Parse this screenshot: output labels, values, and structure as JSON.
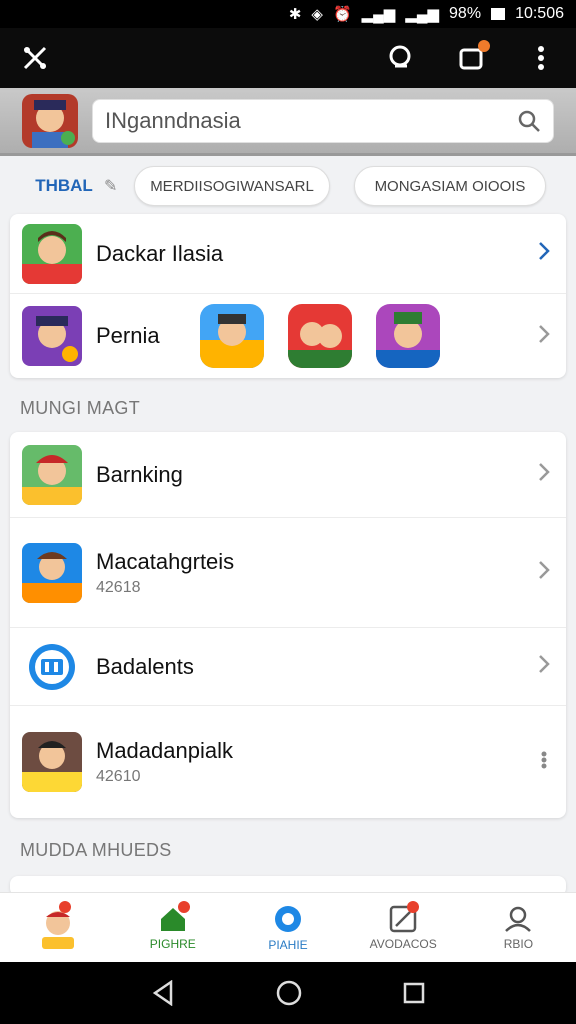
{
  "status_bar": {
    "battery": "98%",
    "time": "10:506"
  },
  "search": {
    "value": "INganndnasia"
  },
  "chips": {
    "tab_label": "THBAL",
    "chip1": "MERDIISOGIWANSARL",
    "chip2": "MONGASIAM OIOOIS"
  },
  "top_card": {
    "rows": [
      {
        "title": "Dackar Ilasia"
      },
      {
        "title": "Pernia"
      }
    ]
  },
  "section1": "MUNGI MAGT",
  "list": {
    "rows": [
      {
        "title": "Barnking",
        "sub": ""
      },
      {
        "title": "Macatahgrteis",
        "sub": "42618"
      },
      {
        "title": "Badalents",
        "sub": ""
      },
      {
        "title": "Madadanpialk",
        "sub": "42610"
      }
    ]
  },
  "section2": "MUDDA MHUEDS",
  "bottom_nav": {
    "items": [
      {
        "label": ""
      },
      {
        "label": "PIGHRE"
      },
      {
        "label": "PIAHIE"
      },
      {
        "label": "AVODACOS"
      },
      {
        "label": "RBIO"
      }
    ]
  },
  "colors": {
    "accent_blue": "#2266b8",
    "notif_orange": "#f07b2b",
    "badge_red": "#e8402c",
    "green": "#2a8a2a"
  },
  "icons": [
    "tools-icon",
    "search-icon",
    "notification-icon",
    "more-vert-icon",
    "chevron-right-icon",
    "home-icon",
    "circle-icon",
    "edit-icon",
    "user-icon",
    "back-icon",
    "home-circle-icon",
    "recents-icon"
  ]
}
